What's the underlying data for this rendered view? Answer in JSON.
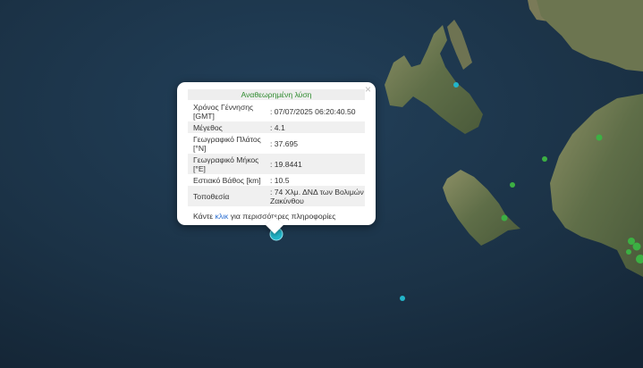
{
  "popup": {
    "title": "Αναθεωρημένη λύση",
    "close_icon": "close-icon",
    "rows": [
      {
        "label": "Χρόνος Γέννησης [GMT]",
        "value": ": 07/07/2025 06:20:40.50"
      },
      {
        "label": "Μέγεθος",
        "value": ": 4.1"
      },
      {
        "label": "Γεωγραφικό Πλάτος [°N]",
        "value": ": 37.695"
      },
      {
        "label": "Γεωγραφικό Μήκος [°E]",
        "value": ": 19.8441"
      },
      {
        "label": "Εστιακό Βάθος [km]",
        "value": ": 10.5"
      },
      {
        "label": "Τοποθεσία",
        "value": ": 74 Χλμ. ΔΝΔ των Βολιμών Ζακύνθου"
      }
    ],
    "footer": {
      "prefix": "Κάντε",
      "link": "κλικ",
      "suffix": "για περισσότερες πληροφορίες"
    }
  },
  "colors": {
    "sea_light": "#1f3a50",
    "sea_dark": "#142535",
    "land": "#6f7a55",
    "selected_marker": "#22b5c9",
    "older_marker": "#3cb043",
    "title_green": "#2e8b2e",
    "link_blue": "#2b6fd1"
  }
}
